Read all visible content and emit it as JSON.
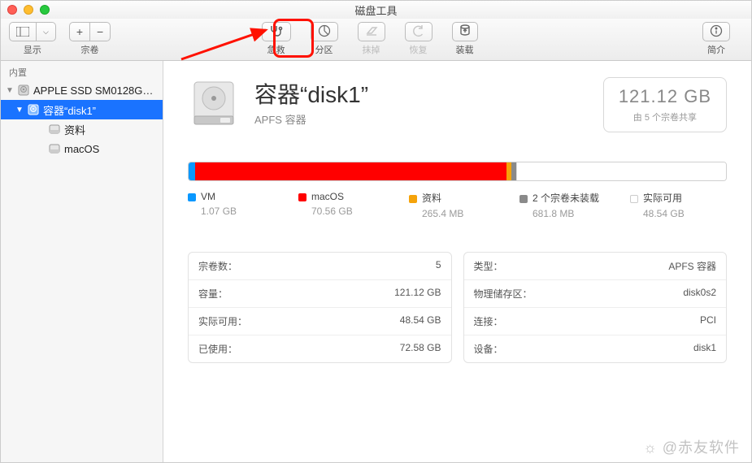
{
  "window": {
    "title": "磁盘工具"
  },
  "toolbar": {
    "view_label": "显示",
    "volume_label": "宗卷",
    "first_aid": "急救",
    "partition": "分区",
    "erase": "抹掉",
    "restore": "恢复",
    "mount": "装载",
    "info": "简介"
  },
  "sidebar": {
    "section": "内置",
    "items": [
      {
        "label": "APPLE SSD SM0128G…",
        "level": 0,
        "expanded": true,
        "selected": false,
        "icon": "hdd"
      },
      {
        "label": "容器“disk1”",
        "level": 1,
        "expanded": true,
        "selected": true,
        "icon": "hdd"
      },
      {
        "label": "资料",
        "level": 2,
        "selected": false,
        "icon": "vol"
      },
      {
        "label": "macOS",
        "level": 2,
        "selected": false,
        "icon": "vol"
      }
    ]
  },
  "header": {
    "title": "容器“disk1”",
    "subtitle": "APFS 容器",
    "capacity": "121.12 GB",
    "capacity_note": "由 5 个宗卷共享"
  },
  "usage": {
    "segments": [
      {
        "name": "VM",
        "value": "1.07 GB",
        "color": "#0a98ff",
        "pct": 1.2
      },
      {
        "name": "macOS",
        "value": "70.56 GB",
        "color": "#ff0000",
        "pct": 58.0
      },
      {
        "name": "资料",
        "value": "265.4 MB",
        "color": "#f5a30a",
        "pct": 0.8
      },
      {
        "name": "2 个宗卷未装载",
        "value": "681.8 MB",
        "color": "#8a8a8a",
        "pct": 0.9
      },
      {
        "name": "实际可用",
        "value": "48.54 GB",
        "color": "#ffffff",
        "pct": 39.1
      }
    ]
  },
  "info_left": [
    {
      "key": "宗卷数：",
      "val": "5"
    },
    {
      "key": "容量：",
      "val": "121.12 GB"
    },
    {
      "key": "实际可用：",
      "val": "48.54 GB"
    },
    {
      "key": "已使用：",
      "val": "72.58 GB"
    }
  ],
  "info_right": [
    {
      "key": "类型：",
      "val": "APFS 容器"
    },
    {
      "key": "物理储存区：",
      "val": "disk0s2"
    },
    {
      "key": "连接：",
      "val": "PCI"
    },
    {
      "key": "设备：",
      "val": "disk1"
    }
  ],
  "watermark": "@赤友软件",
  "chart_data": {
    "type": "bar",
    "title": "容器“disk1” 用量",
    "categories": [
      "VM",
      "macOS",
      "资料",
      "2 个宗卷未装载",
      "实际可用"
    ],
    "values_gb": [
      1.07,
      70.56,
      0.2654,
      0.6818,
      48.54
    ],
    "total_gb": 121.12
  },
  "annotation": {
    "highlight_target": "first-aid-button"
  }
}
